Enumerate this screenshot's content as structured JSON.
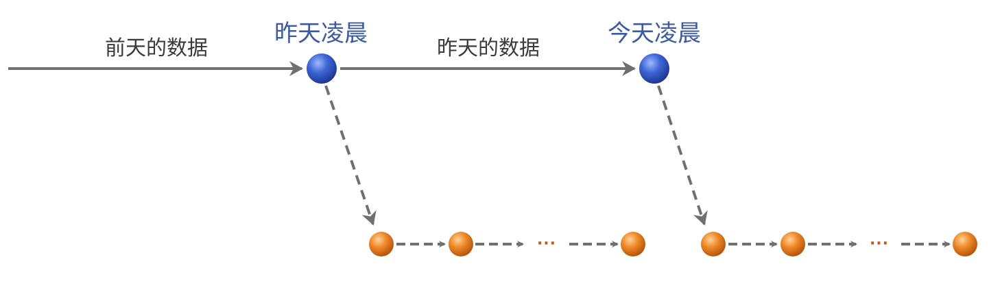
{
  "labels": {
    "day_before_data": "前天的数据",
    "yesterday_dawn": "昨天凌晨",
    "yesterday_data": "昨天的数据",
    "today_dawn": "今天凌晨",
    "ellipsis_1": "···",
    "ellipsis_2": "···"
  },
  "colors": {
    "blue_node": "#3a5fc4",
    "orange_node": "#e07a1f",
    "arrow": "#707070",
    "label_text": "#3a3a3a",
    "highlight_text": "#3d5a9e",
    "ellipsis": "#c0581a"
  }
}
